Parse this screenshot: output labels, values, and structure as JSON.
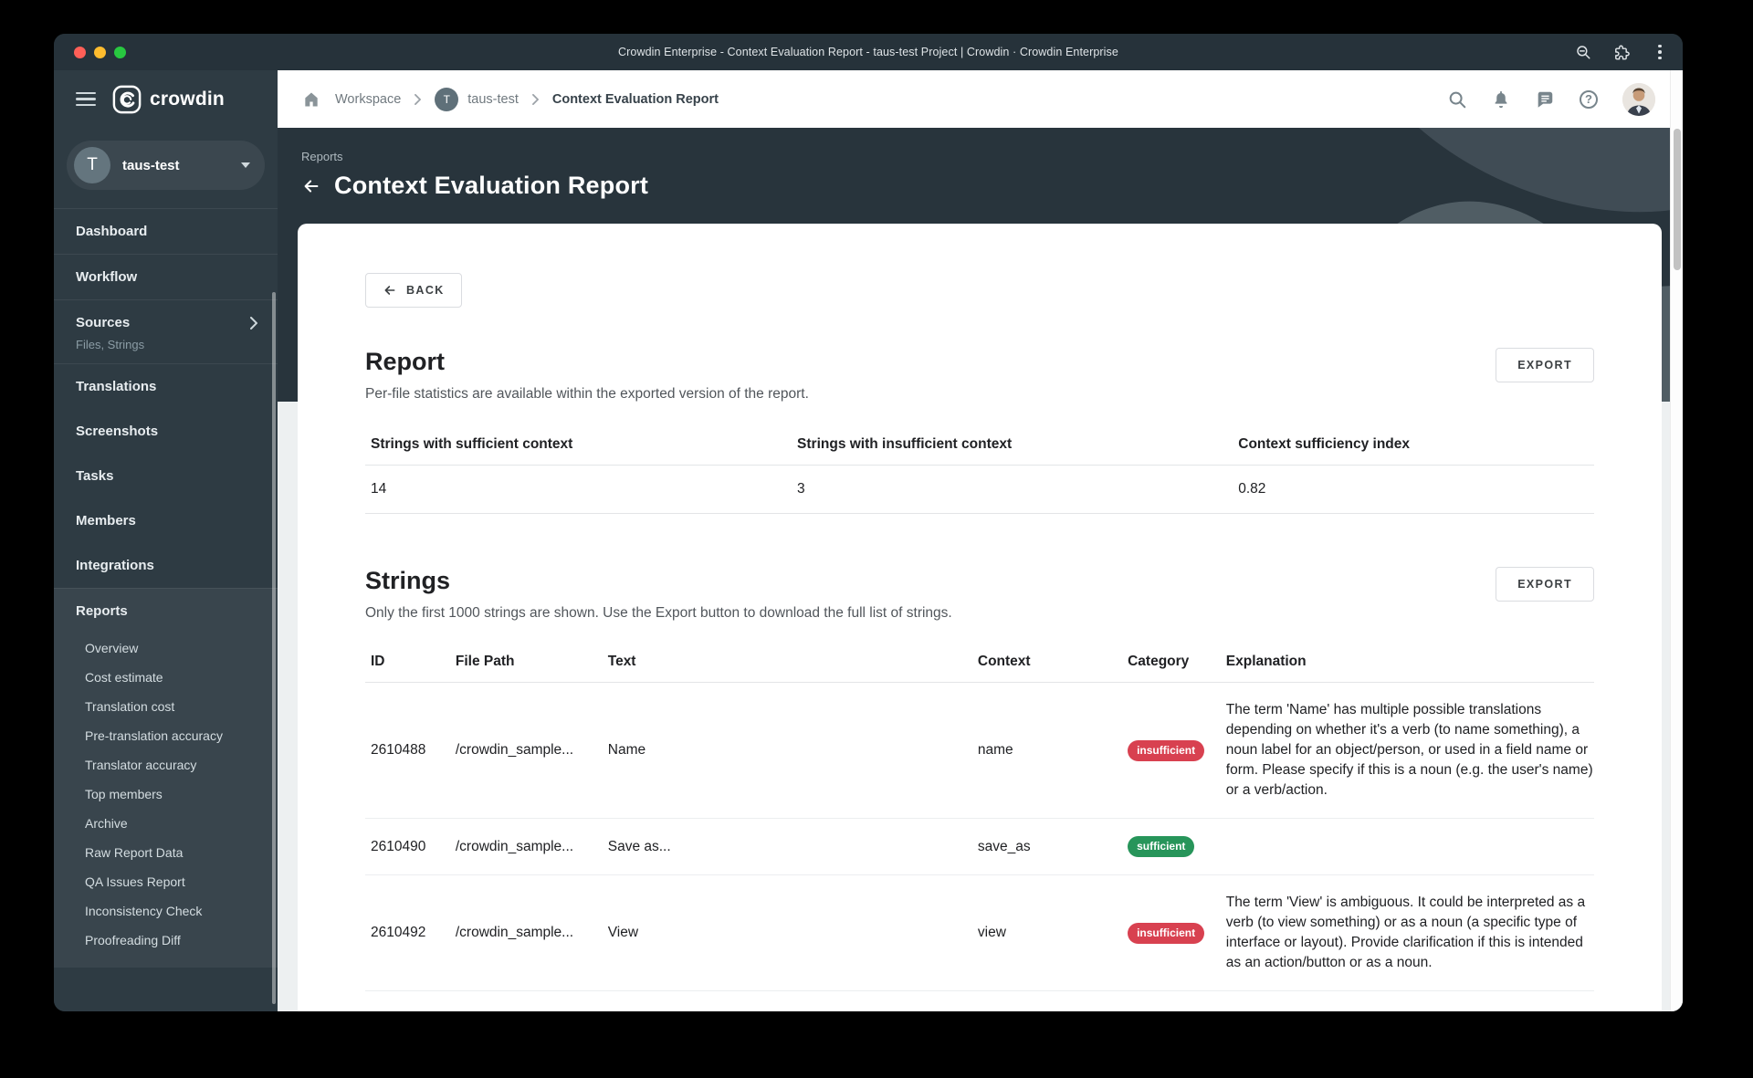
{
  "browser": {
    "title": "Crowdin Enterprise - Context Evaluation Report - taus-test Project | Crowdin · Crowdin Enterprise",
    "icons": [
      "zoom-out-icon",
      "extensions-icon",
      "menu-icon"
    ]
  },
  "brand": {
    "name": "crowdin"
  },
  "header": {
    "breadcrumb": [
      {
        "label": "Workspace"
      },
      {
        "label": "taus-test",
        "initial": "T"
      },
      {
        "label": "Context Evaluation Report"
      }
    ],
    "icons": [
      "search",
      "notifications",
      "messages",
      "help"
    ],
    "help_glyph": "?"
  },
  "sidebar": {
    "project": {
      "initial": "T",
      "name": "taus-test"
    },
    "items": [
      {
        "label": "Dashboard"
      },
      {
        "label": "Workflow"
      },
      {
        "label": "Sources",
        "sublabel": "Files, Strings"
      },
      {
        "label": "Translations"
      },
      {
        "label": "Screenshots"
      },
      {
        "label": "Tasks"
      },
      {
        "label": "Members"
      },
      {
        "label": "Integrations"
      },
      {
        "label": "Reports"
      }
    ],
    "report_subitems": [
      {
        "label": "Overview"
      },
      {
        "label": "Cost estimate"
      },
      {
        "label": "Translation cost"
      },
      {
        "label": "Pre-translation accuracy"
      },
      {
        "label": "Translator accuracy"
      },
      {
        "label": "Top members"
      },
      {
        "label": "Archive"
      },
      {
        "label": "Raw Report Data"
      },
      {
        "label": "QA Issues Report"
      },
      {
        "label": "Inconsistency Check"
      },
      {
        "label": "Proofreading Diff"
      }
    ]
  },
  "page": {
    "eyebrow": "Reports",
    "title": "Context Evaluation Report",
    "back_label": "BACK"
  },
  "report_section": {
    "heading": "Report",
    "subtitle": "Per-file statistics are available within the exported version of the report.",
    "export_label": "EXPORT",
    "stats": {
      "columns": [
        "Strings with sufficient context",
        "Strings with insufficient context",
        "Context sufficiency index"
      ],
      "values": [
        "14",
        "3",
        "0.82"
      ]
    }
  },
  "strings_section": {
    "heading": "Strings",
    "subtitle": "Only the first 1000 strings are shown. Use the Export button to download the full list of strings.",
    "export_label": "EXPORT",
    "table": {
      "columns": [
        "ID",
        "File Path",
        "Text",
        "Context",
        "Category",
        "Explanation"
      ],
      "rows": [
        {
          "id": "2610488",
          "file_path": "/crowdin_sample...",
          "text": "Name",
          "context": "name",
          "category": {
            "label": "insufficient",
            "variant": "insufficient"
          },
          "explanation": "The term 'Name' has multiple possible translations depending on whether it's a verb (to name something), a noun label for an object/person, or used in a field name or form. Please specify if this is a noun (e.g. the user's name) or a verb/action."
        },
        {
          "id": "2610490",
          "file_path": "/crowdin_sample...",
          "text": "Save as...",
          "context": "save_as",
          "category": {
            "label": "sufficient",
            "variant": "sufficient"
          },
          "explanation": ""
        },
        {
          "id": "2610492",
          "file_path": "/crowdin_sample...",
          "text": "View",
          "context": "view",
          "category": {
            "label": "insufficient",
            "variant": "insufficient"
          },
          "explanation": "The term 'View' is ambiguous. It could be interpreted as a verb (to view something) or as a noun (a specific type of interface or layout). Provide clarification if this is intended as an action/button or as a noun."
        }
      ]
    }
  },
  "colors": {
    "badge_insufficient": "#d84150",
    "badge_sufficient": "#27955a",
    "sidebar_bg": "#2e3b43",
    "header_dark": "#28343c",
    "accent_dark": "#26323a"
  }
}
